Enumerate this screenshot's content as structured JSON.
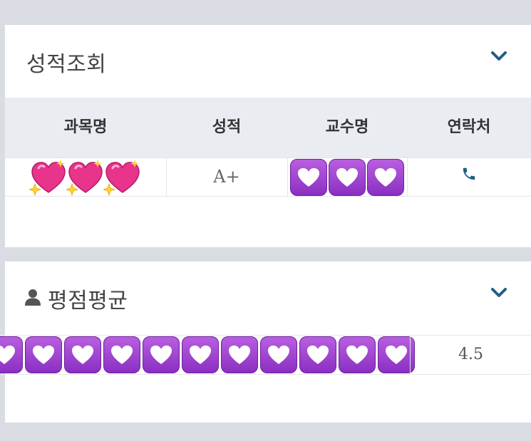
{
  "grades_card": {
    "title": "성적조회",
    "chevron_icon": "chevron-down-icon",
    "columns": [
      "과목명",
      "성적",
      "교수명",
      "연락처"
    ],
    "rows": [
      {
        "subject": "(obscured by sparkling-heart emoji x3)",
        "grade": "A+",
        "professor": "(obscured by white-heart emoji x3)",
        "contact_icon": "phone-icon"
      }
    ]
  },
  "gpa_card": {
    "title": "평점평균",
    "person_icon": "person-icon",
    "chevron_icon": "chevron-down-icon",
    "value": "4.5"
  },
  "colors": {
    "page_bg": "#d9dde3",
    "header_bg": "#e9edf2",
    "accent": "#1f5f86",
    "emoji_purple": "#9b3fd0"
  }
}
